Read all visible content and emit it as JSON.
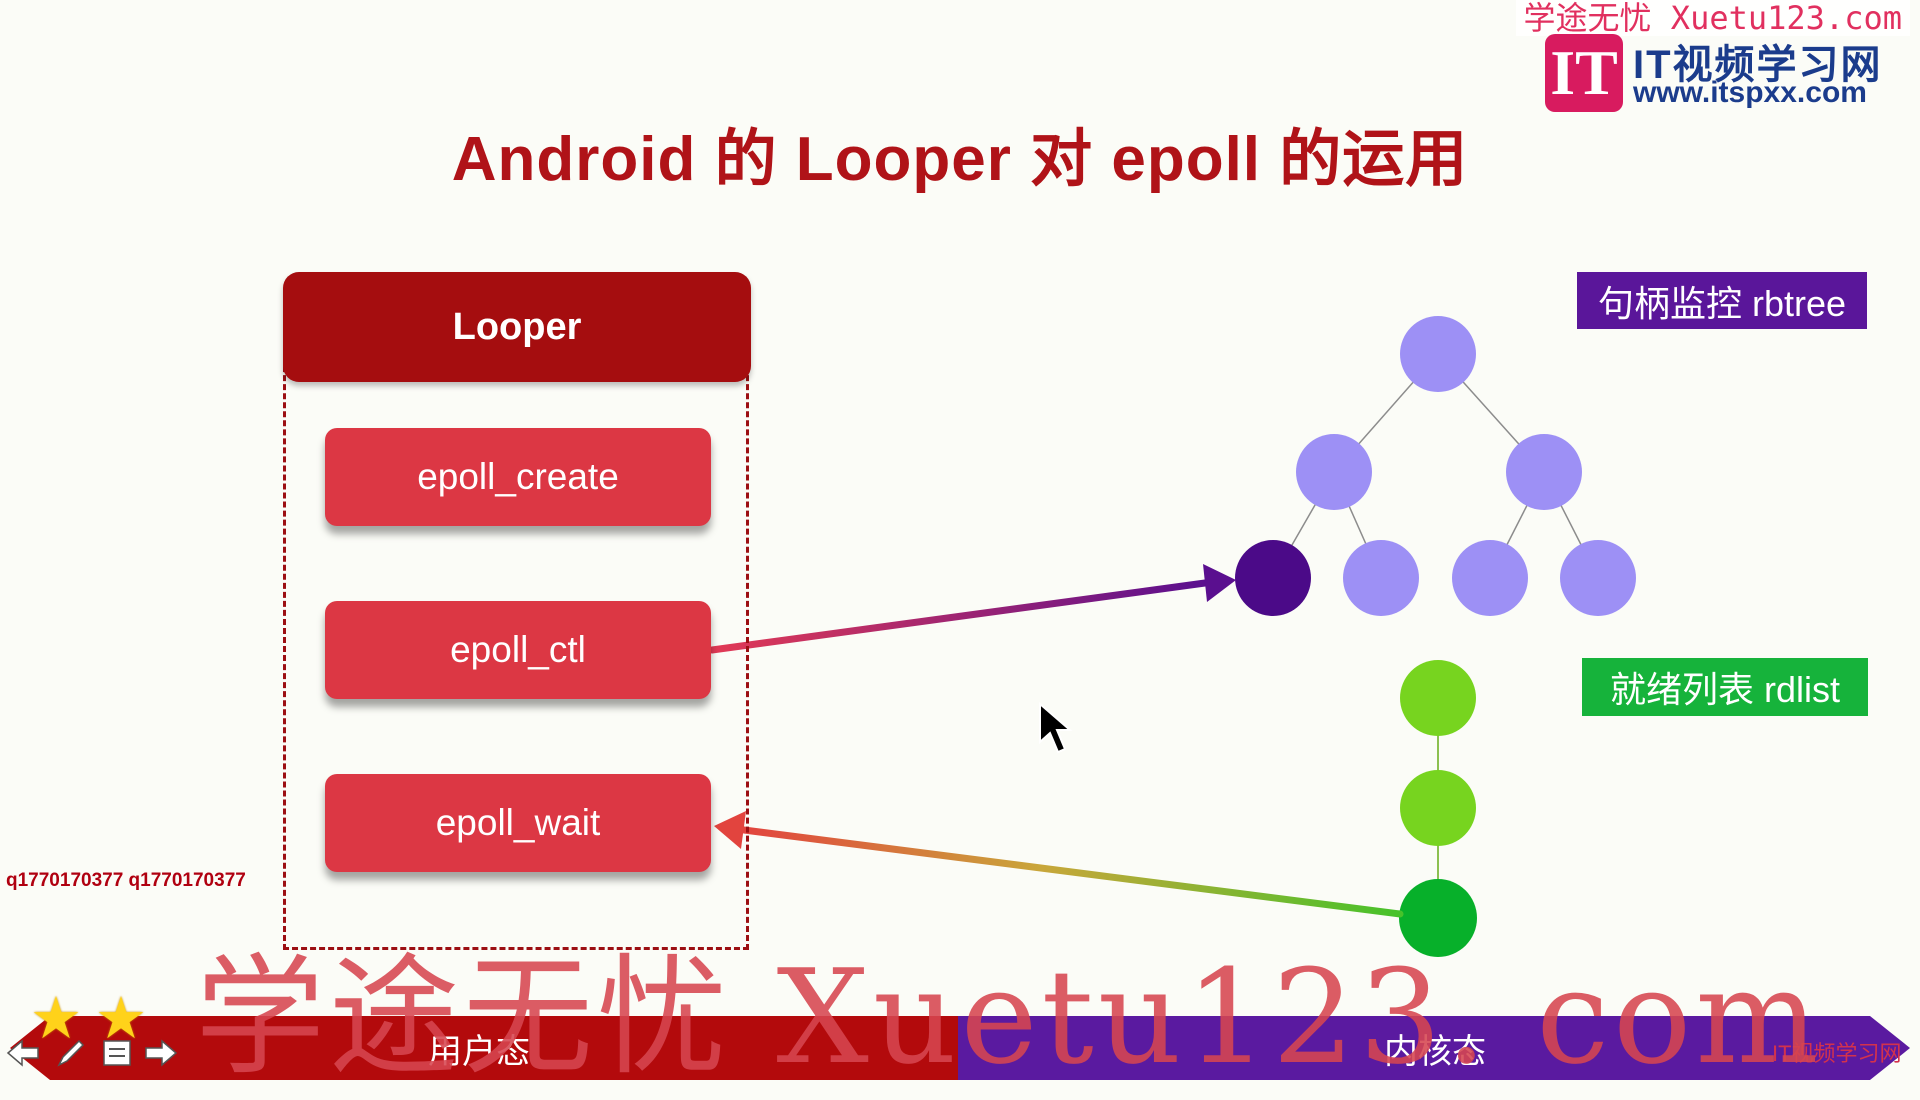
{
  "slide": {
    "title": "Android 的 Looper 对 epoll 的运用"
  },
  "watermarks": {
    "top_right": "学途无忧 Xuetu123.com",
    "logo_mark": "IT",
    "logo_name": "IT视频学习网",
    "logo_url": "www.itspxx.com",
    "center": "学途无忧 Xuetu123. com",
    "qq": "q1770170377 q1770170377",
    "bar_corner": "IT视频学习网"
  },
  "looper": {
    "header": "Looper",
    "functions": [
      "epoll_create",
      "epoll_ctl",
      "epoll_wait"
    ]
  },
  "kernel": {
    "rbtree_tag": "句柄监控 rbtree",
    "rdlist_tag": "就绪列表 rdlist"
  },
  "bottom_bar": {
    "user_label": "用户态",
    "kernel_label": "内核态"
  },
  "colors": {
    "title": "#b01318",
    "looper_header": "#a50d0f",
    "function_button": "#dc3744",
    "rbtree_node": "#9d90f5",
    "rbtree_selected_node": "#4b0a88",
    "rdlist_node": "#77d41f",
    "rdlist_active_node": "#07b02a",
    "user_bar": "#b30a0c",
    "kernel_bar": "#5a1aa0"
  },
  "icons": {
    "toolbar": [
      "prev-arrow-icon",
      "pen-icon",
      "menu-icon",
      "next-arrow-icon"
    ],
    "stars": 2,
    "cursor": "mouse-pointer-icon"
  }
}
